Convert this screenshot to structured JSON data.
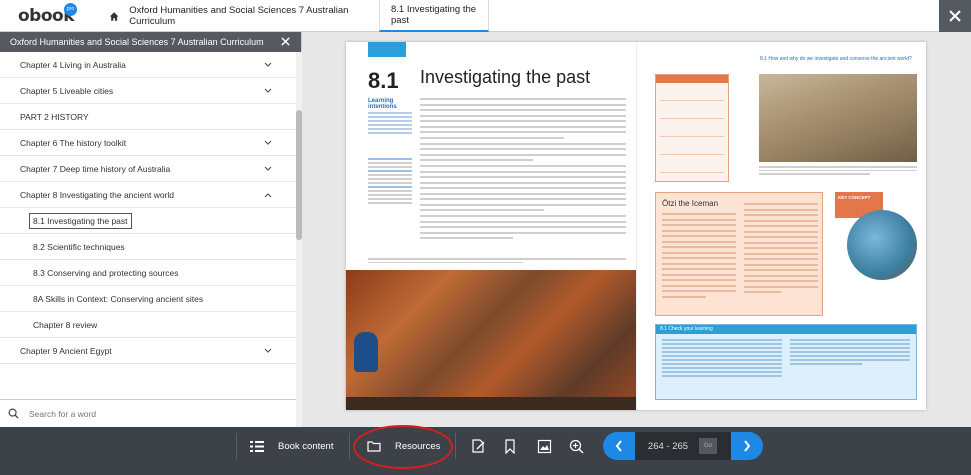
{
  "app": {
    "logo": "obook",
    "logo_badge": "pro",
    "book_tab": "Oxford Humanities and Social Sciences 7 Australian Curriculum",
    "section_tab": "8.1 Investigating the past"
  },
  "sidebar": {
    "title": "Oxford Humanities and Social Sciences 7 Australian Curriculum",
    "items": [
      {
        "label": "Chapter 4 Living in Australia",
        "expandable": true
      },
      {
        "label": "Chapter 5 Liveable cities",
        "expandable": true
      },
      {
        "label": "PART 2 HISTORY",
        "expandable": false
      },
      {
        "label": "Chapter 6 The history toolkit",
        "expandable": true
      },
      {
        "label": "Chapter 7 Deep time history of Australia",
        "expandable": true
      },
      {
        "label": "Chapter 8 Investigating the ancient world",
        "expandable": true,
        "expanded": true
      },
      {
        "label": "8.1 Investigating the past",
        "sub": true,
        "active": true
      },
      {
        "label": "8.2 Scientific techniques",
        "sub": true
      },
      {
        "label": "8.3 Conserving and protecting sources",
        "sub": true
      },
      {
        "label": "8A Skills in Context: Conserving ancient sites",
        "sub": true
      },
      {
        "label": "Chapter 8 review",
        "sub": true
      },
      {
        "label": "Chapter 9 Ancient Egypt",
        "expandable": true
      }
    ],
    "search_placeholder": "Search for a word"
  },
  "page": {
    "section_number": "8.1",
    "section_title": "Investigating the past",
    "learning_intentions": "Learning intentions",
    "right_heading": "8.1 How and why do we investigate and conserve the ancient world?",
    "otzi_title": "Ötzi the Iceman",
    "key_concept": "KEY CONCEPT",
    "check_title": "8.1 Check your learning"
  },
  "toolbar": {
    "book_content": "Book content",
    "resources": "Resources",
    "page_range": "264 - 265",
    "go": "Go"
  },
  "colors": {
    "accent": "#1e88e5",
    "toolbar_bg": "#3d4148",
    "sidebar_header": "#555a61",
    "highlight": "#d91e1e"
  }
}
